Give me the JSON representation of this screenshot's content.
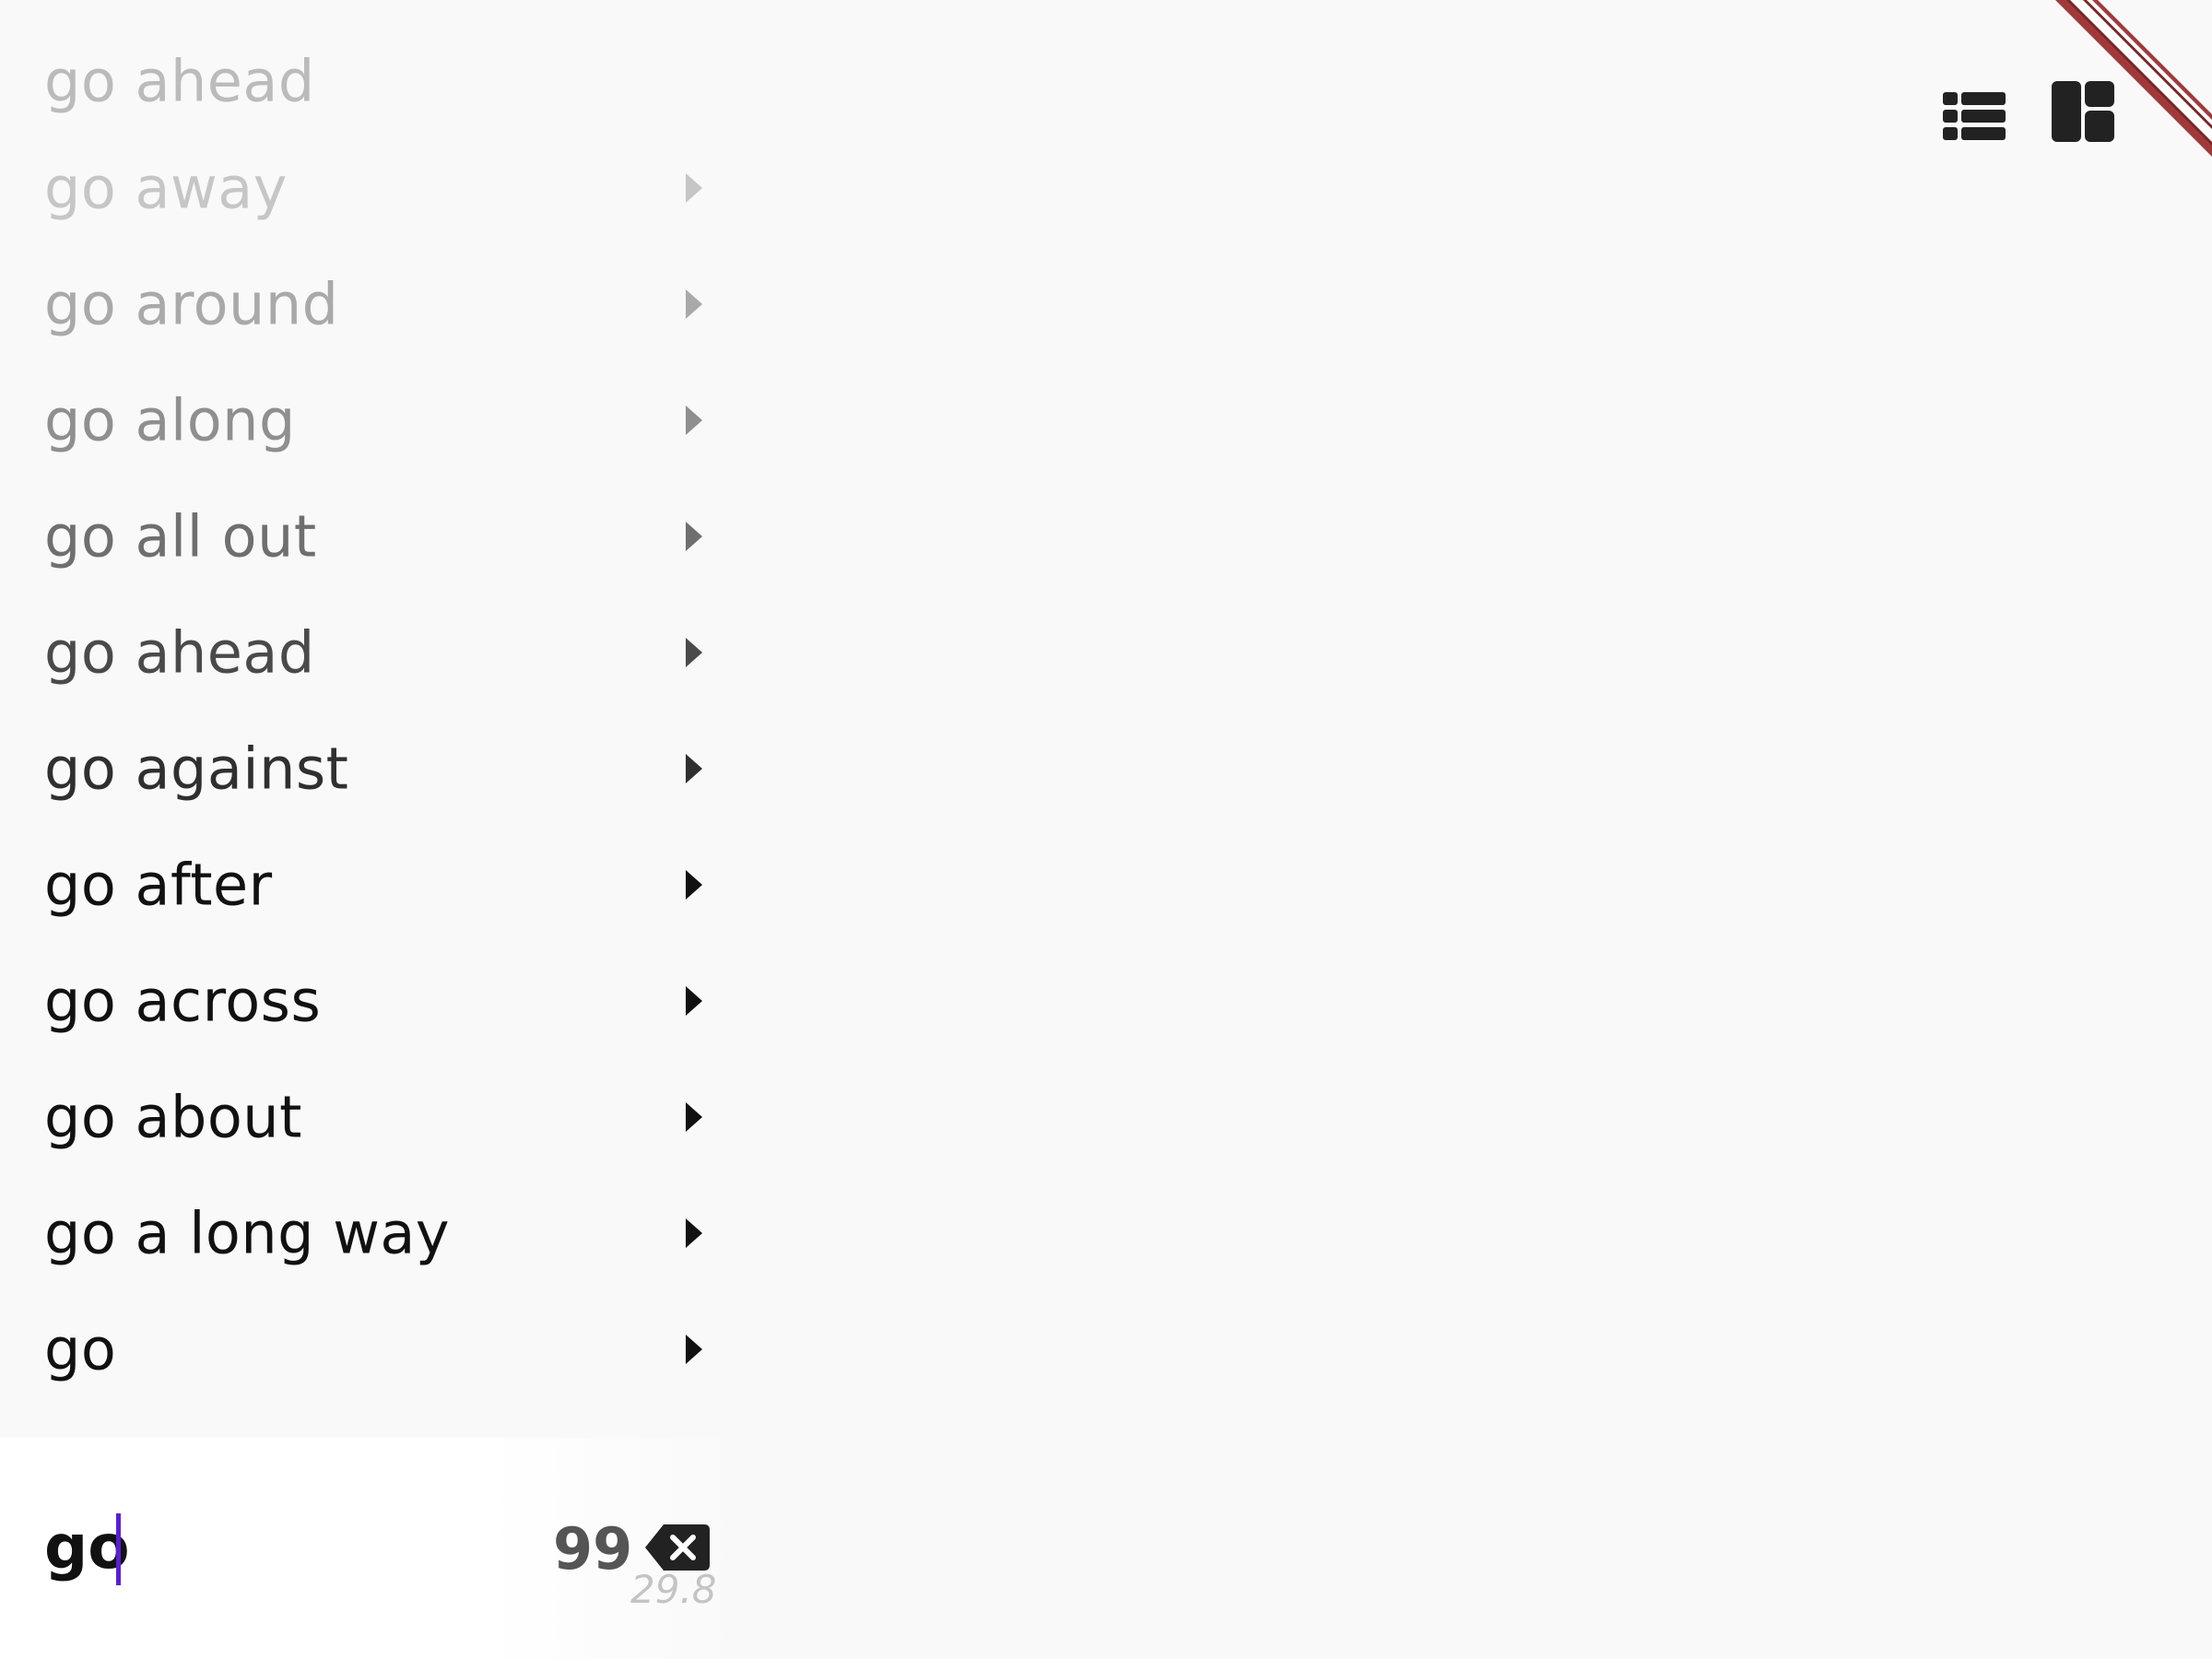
{
  "results": {
    "items": [
      {
        "label": "go ahead",
        "color": "#bbbbbb"
      },
      {
        "label": "go away",
        "color": "#c6c6c6"
      },
      {
        "label": "go around",
        "color": "#a9a9a9"
      },
      {
        "label": "go along",
        "color": "#8f8f8f"
      },
      {
        "label": "go all out",
        "color": "#6f6f6f"
      },
      {
        "label": "go ahead",
        "color": "#4a4a4a"
      },
      {
        "label": "go against",
        "color": "#2f2f2f"
      },
      {
        "label": "go after",
        "color": "#111111"
      },
      {
        "label": "go across",
        "color": "#111111"
      },
      {
        "label": "go about",
        "color": "#111111"
      },
      {
        "label": "go a long way",
        "color": "#111111"
      },
      {
        "label": "go",
        "color": "#111111"
      }
    ]
  },
  "search": {
    "query": "go",
    "result_count": "99",
    "timing": "29.8"
  },
  "toolbar": {
    "list_view_icon": "list-view-icon",
    "dashboard_view_icon": "dashboard-view-icon"
  },
  "colors": {
    "accent_caret": "#5a1ed6",
    "ribbon": "#a03a3a",
    "icon": "#222222"
  }
}
